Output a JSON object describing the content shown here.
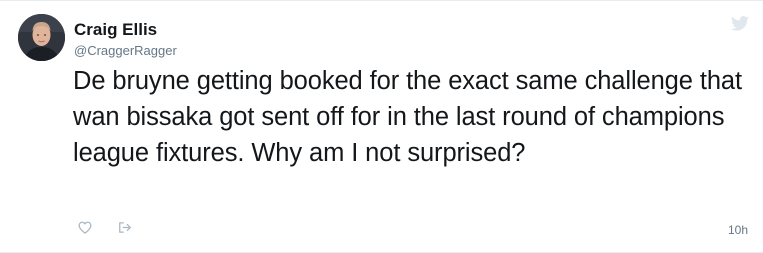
{
  "tweet": {
    "author": {
      "display_name": "Craig Ellis",
      "handle": "@CraggerRagger",
      "avatar_icon": "profile-photo"
    },
    "text": "De bruyne getting booked for the exact same challenge that wan bissaka got sent off for in the last round of champions league fixtures. Why am I not surprised?",
    "timestamp": "10h",
    "actions": {
      "like_icon": "heart-icon",
      "share_icon": "share-icon"
    },
    "brand_icon": "twitter-bird-icon"
  },
  "colors": {
    "text_primary": "#14171a",
    "text_secondary": "#657786",
    "icon_gray": "#aab8c2",
    "divider": "#e6ecf0",
    "bird": "#e1e8ed"
  }
}
